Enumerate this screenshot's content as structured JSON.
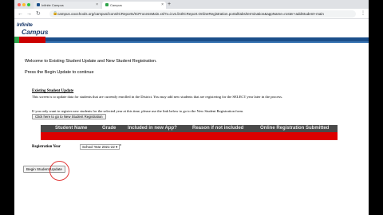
{
  "browser": {
    "tabs": [
      {
        "label": "Infinite Campus",
        "active": false
      },
      {
        "label": "Campus",
        "active": true
      }
    ],
    "new_tab_label": "+",
    "url": "campus.ooochools.org/campus/icons/ICReports/ICProcessMain.xsl?x=icvs.list/ICReport.OnlineRegistration.portal/tabs/termination&appName=roster+addStudent+main",
    "colors": {
      "tabstrip": "#dfe1e5",
      "urlbar": "#f1f3f4"
    }
  },
  "header": {
    "logo_top": "Infinite",
    "logo_bottom": "Campus",
    "colors": {
      "band": "#1b4f8a",
      "green": "#2ea34a",
      "red": "#cc0000"
    }
  },
  "page": {
    "welcome": "Welcome to Existing Student Update and New Student Registration.",
    "instruction": "Press the Begin Update to continue",
    "existing_title": "Existing Student Update",
    "existing_para": "This screen is to update data for students that are currently enrolled in the District. You may add new students that are registering for the SELECT year later in the process.",
    "new_reg_para": "If you only want to register new students for the selected year at this time, please use the link below to go to the New Student Registration form.",
    "new_reg_button": "Click here to go to New Student Registration",
    "table_headers": [
      "Student Name",
      "Grade",
      "Included in new App?",
      "Reason if not included",
      "Online Registration Submitted"
    ],
    "reg_year_label": "Registration Year",
    "reg_year_value": "School Year 2021-22 ▾",
    "reg_year_required": "*",
    "begin_button": "Begin Student Update"
  }
}
